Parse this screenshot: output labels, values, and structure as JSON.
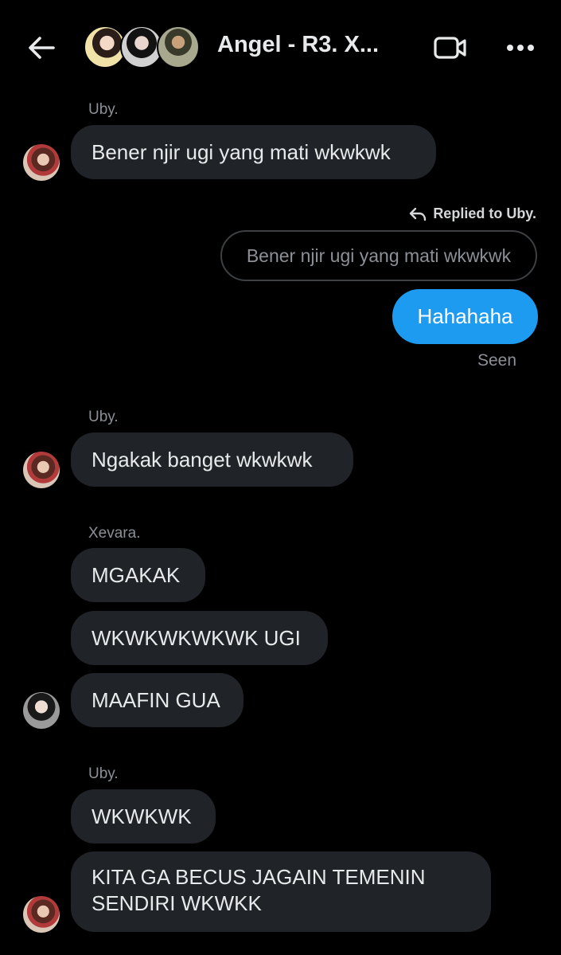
{
  "header": {
    "title": "Angel - R3. X...",
    "back_icon": "arrow-left-icon",
    "video_icon": "video-camera-icon",
    "more_icon": "more-horizontal-icon"
  },
  "messages": {
    "m1": {
      "sender": "Uby.",
      "text": "Bener njir ugi yang mati wkwkwk"
    },
    "reply": {
      "note": "Replied to Uby.",
      "quoted": "Bener njir ugi yang mati wkwkwk",
      "text": "Hahahaha",
      "status": "Seen"
    },
    "m2": {
      "sender": "Uby.",
      "text": "Ngakak banget wkwkwk"
    },
    "m3": {
      "sender": "Xevara.",
      "lines": [
        "MGAKAK",
        "WKWKWKWKWK UGI",
        "MAAFIN GUA"
      ]
    },
    "m4": {
      "sender": "Uby.",
      "line1": "WKWKWK",
      "line2a": "KITA GA BECUS JAGAIN TEMENIN",
      "line2b": "SENDIRI WKWKK"
    }
  },
  "colors": {
    "background": "#000000",
    "bubble_received": "#202327",
    "bubble_sent": "#1d9bf0",
    "muted_text": "#8b9096"
  }
}
